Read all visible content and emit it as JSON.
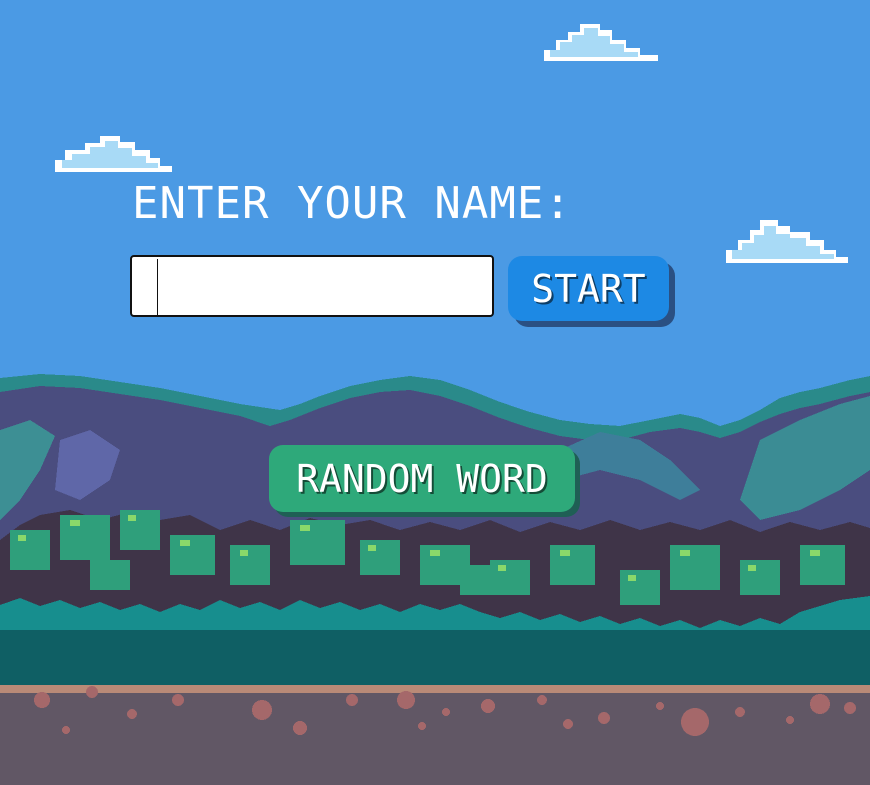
{
  "prompt": {
    "label": "ENTER YOUR NAME:"
  },
  "name_input": {
    "value": "",
    "placeholder": ""
  },
  "start_button": {
    "label": "START"
  },
  "random_button": {
    "label": "RANDOM WORD"
  },
  "colors": {
    "sky": "#4b9ae4",
    "start_button": "#1d89e4",
    "random_button": "#2ea97a",
    "mountain": "#4a4d7f",
    "foliage": "#2f9f7b",
    "ground": "#615765"
  },
  "icons": [
    "cloud-icon",
    "cloud-icon",
    "cloud-icon"
  ]
}
